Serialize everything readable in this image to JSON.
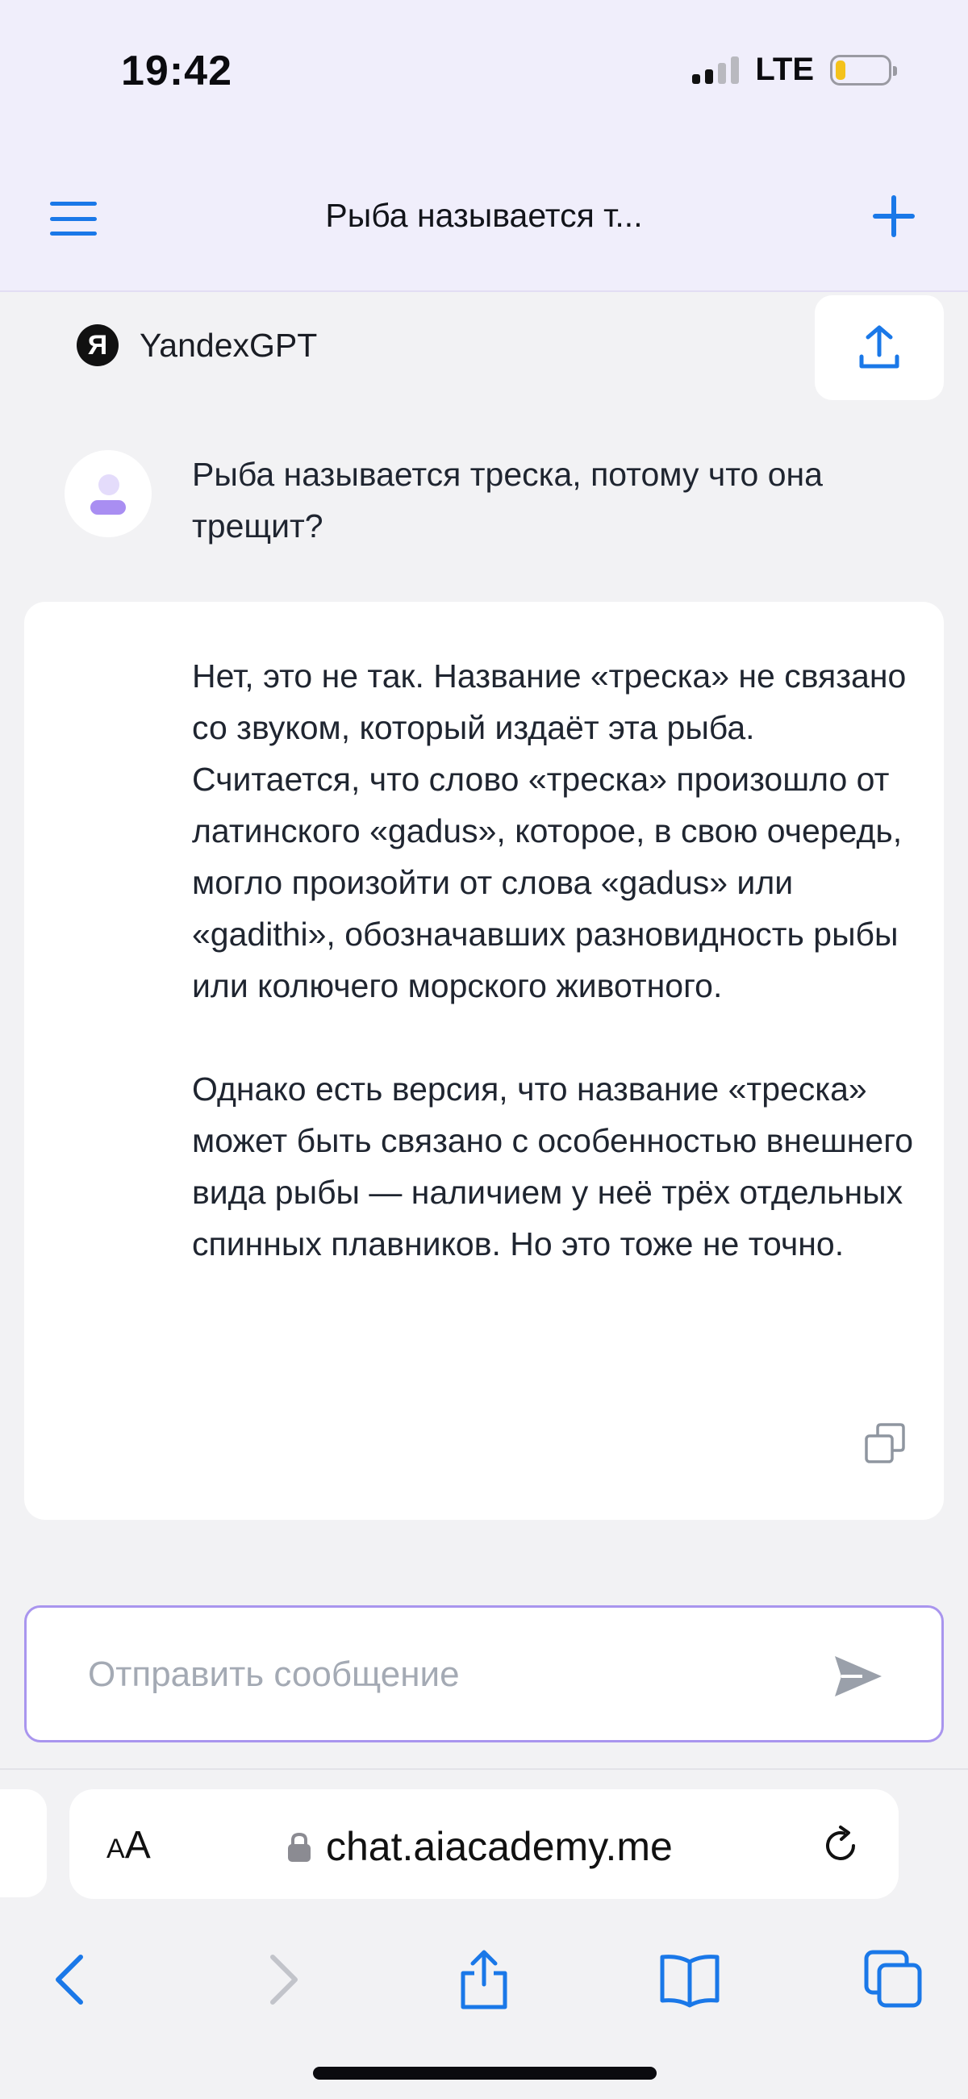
{
  "status_bar": {
    "time": "19:42",
    "network": "LTE"
  },
  "header": {
    "title": "Рыба называется т...",
    "menu_icon": "menu-icon",
    "new_chat_icon": "plus-icon"
  },
  "model": {
    "logo": "Я",
    "name": "YandexGPT",
    "share_icon": "share-icon"
  },
  "conversation": {
    "user_message": "Рыба называется треска, потому что она трещит?",
    "assistant_paragraphs": [
      "Нет, это не так. Название «треска» не связано со звуком, который издаёт эта рыба. Считается, что слово «треска» произошло от латинского «gadus», которое, в свою очередь, могло произойти от слова «gadus» или «gadithi», обозначавших разновидность рыбы или колючего морского животного.",
      "Однако есть версия, что название «треска» может быть связано с особенностью внешнего вида рыбы — наличием у неё трёх отдельных спинных плавников. Но это тоже не точно."
    ]
  },
  "composer": {
    "placeholder": "Отправить сообщение",
    "value": ""
  },
  "browser": {
    "aa_label_small": "A",
    "aa_label_large": "A",
    "url": "chat.aiacademy.me"
  },
  "colors": {
    "accent": "#1a78e8",
    "input_border": "#a995ee",
    "header_bg": "#f0eefb"
  }
}
